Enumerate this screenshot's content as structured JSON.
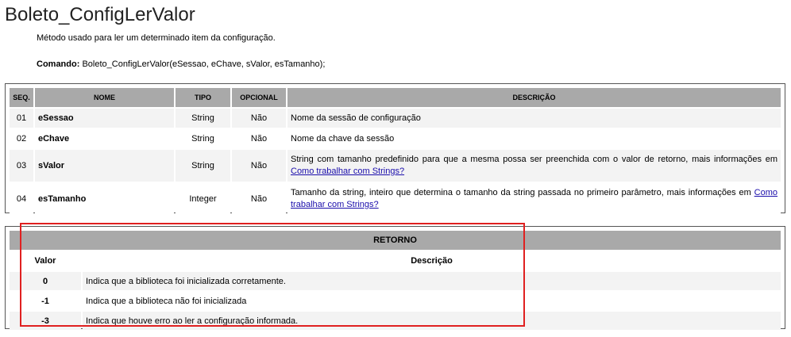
{
  "title": "Boleto_ConfigLerValor",
  "description": "Método usado para ler um determinado item  da configuração.",
  "command": {
    "label": "Comando:",
    "value": " Boleto_ConfigLerValor(eSessao, eChave, sValor, esTamanho);"
  },
  "params": {
    "headers": {
      "seq": "SEQ.",
      "nome": "NOME",
      "tipo": "TIPO",
      "opcional": "OPCIONAL",
      "descricao": "DESCRIÇÃO"
    },
    "rows": [
      {
        "seq": "01",
        "nome": "eSessao",
        "tipo": "String",
        "opcional": "Não",
        "descricao": "Nome da sessão de configuração",
        "link": ""
      },
      {
        "seq": "02",
        "nome": "eChave",
        "tipo": "String",
        "opcional": "Não",
        "descricao": "Nome da chave da sessão",
        "link": ""
      },
      {
        "seq": "03",
        "nome": "sValor",
        "tipo": "String",
        "opcional": "Não",
        "descricao": "String com tamanho predefinido para que a mesma possa ser preenchida com o valor de retorno, mais informações em ",
        "link": "Como trabalhar com Strings?"
      },
      {
        "seq": "04",
        "nome": "esTamanho",
        "tipo": "Integer",
        "opcional": "Não",
        "descricao": "Tamanho da string, inteiro que determina o tamanho da string passada no primeiro parâmetro, mais informações em ",
        "link": "Como trabalhar com Strings?"
      }
    ]
  },
  "retorno": {
    "title": "RETORNO",
    "col_valor": "Valor",
    "col_descricao": "Descrição",
    "rows": [
      {
        "valor": "0",
        "descricao": "Indica que a biblioteca foi inicializada corretamente."
      },
      {
        "valor": "-1",
        "descricao": "Indica que a biblioteca não foi inicializada"
      },
      {
        "valor": "-3",
        "descricao": "Indica que houve erro ao ler a configuração informada."
      }
    ]
  },
  "highlight_color": "#e02020"
}
